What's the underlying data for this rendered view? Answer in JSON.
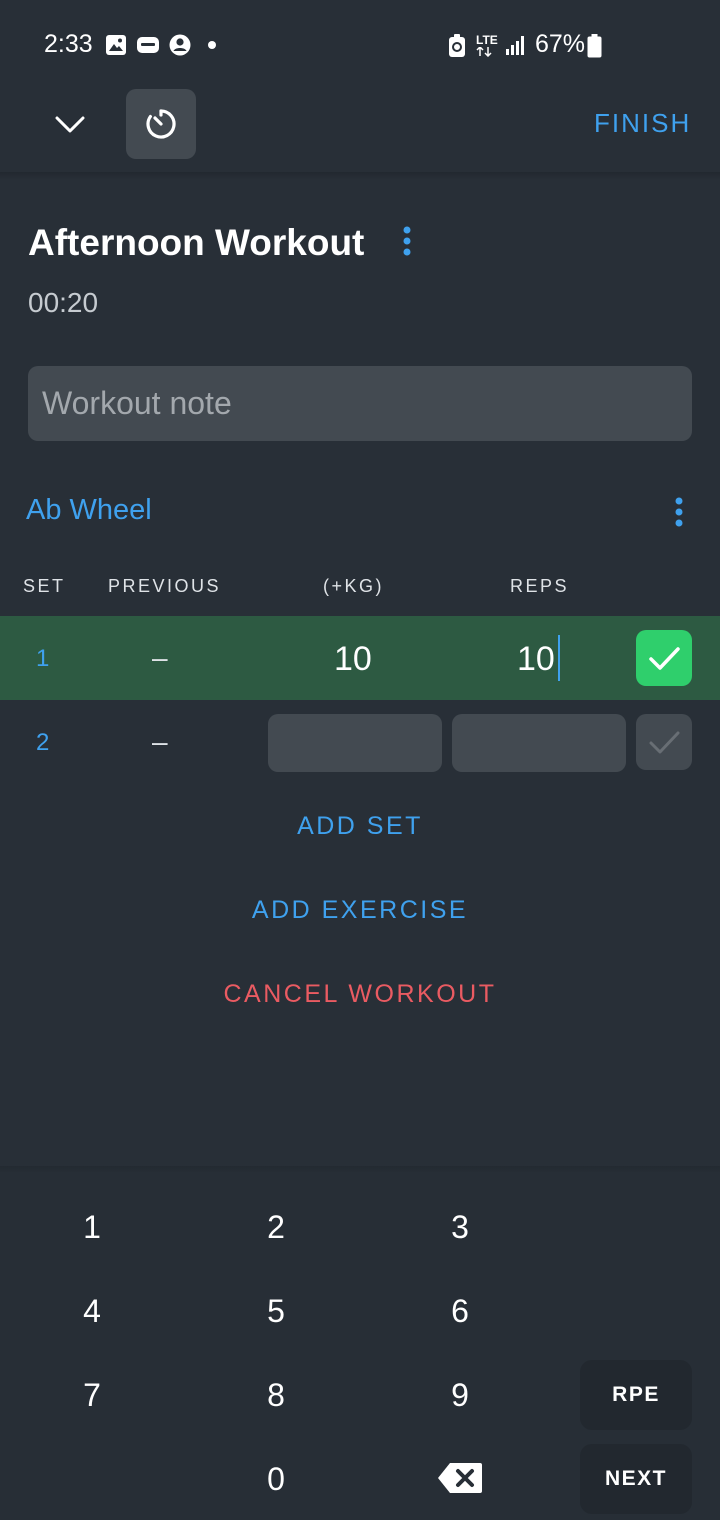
{
  "status_bar": {
    "time": "2:33",
    "battery_percent": "67%",
    "network": "LTE",
    "notification_icons": [
      "image-icon",
      "app-icon",
      "account-icon",
      "dot-icon"
    ]
  },
  "toolbar": {
    "finish_label": "FINISH"
  },
  "workout": {
    "title": "Afternoon Workout",
    "elapsed": "00:20",
    "note_placeholder": "Workout note"
  },
  "exercise": {
    "name": "Ab Wheel",
    "columns": {
      "set": "SET",
      "previous": "PREVIOUS",
      "weight": "(+KG)",
      "reps": "REPS"
    },
    "sets": [
      {
        "number": "1",
        "previous": "–",
        "weight": "10",
        "reps": "10",
        "completed": true
      },
      {
        "number": "2",
        "previous": "–",
        "weight": "",
        "reps": "",
        "completed": false
      }
    ]
  },
  "actions": {
    "add_set": "ADD SET",
    "add_exercise": "ADD EXERCISE",
    "cancel_workout": "CANCEL WORKOUT"
  },
  "keypad": {
    "keys": [
      "1",
      "2",
      "3",
      "4",
      "5",
      "6",
      "7",
      "8",
      "9",
      "0"
    ],
    "rpe_label": "RPE",
    "next_label": "NEXT"
  },
  "colors": {
    "background": "#282f37",
    "accent": "#3fa1ee",
    "danger": "#ea5b62",
    "completed_row": "#2d5a42",
    "completed_check": "#2fcf6c"
  }
}
